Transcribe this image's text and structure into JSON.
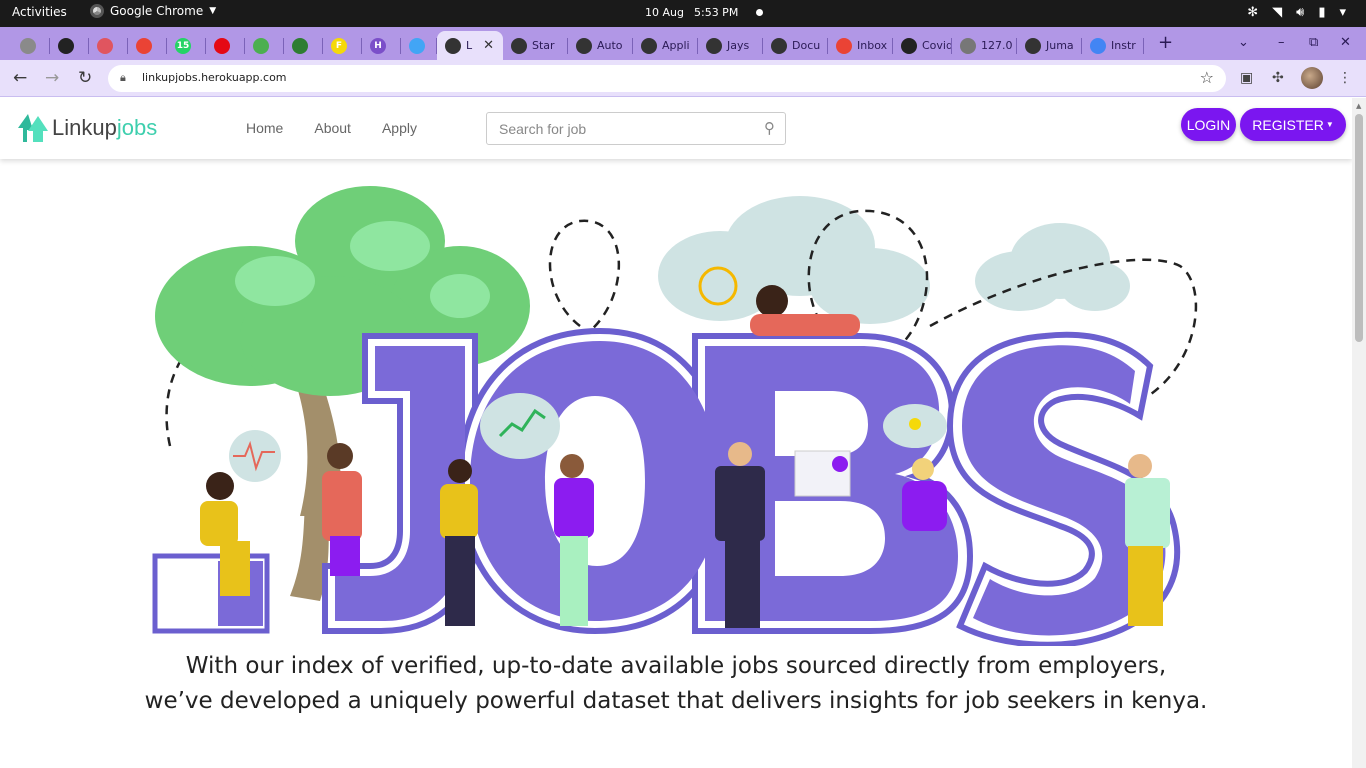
{
  "system": {
    "activities": "Activities",
    "app_name": "Google Chrome",
    "date": "10 Aug",
    "time": "5:53 PM"
  },
  "tabs": [
    {
      "label": "",
      "color": "#8a8a8a"
    },
    {
      "label": "",
      "color": "#222222"
    },
    {
      "label": "",
      "color": "#e0555f"
    },
    {
      "label": "",
      "color": "#ea4335"
    },
    {
      "label": "15",
      "color": "#25d366"
    },
    {
      "label": "",
      "color": "#e50914"
    },
    {
      "label": "",
      "color": "#4caf50"
    },
    {
      "label": "",
      "color": "#2e7d32"
    },
    {
      "label": "F",
      "color": "#f5d90a"
    },
    {
      "label": "H",
      "color": "#7b4fc9"
    },
    {
      "label": "",
      "color": "#42a5f5"
    },
    {
      "label": "L",
      "color": "#333333"
    },
    {
      "label": "Star",
      "color": "#333333"
    },
    {
      "label": "Auto",
      "color": "#333333"
    },
    {
      "label": "Appli",
      "color": "#333333"
    },
    {
      "label": "Jays",
      "color": "#333333"
    },
    {
      "label": "Docu",
      "color": "#333333"
    },
    {
      "label": "Inbox",
      "color": "#ea4335"
    },
    {
      "label": "Covid",
      "color": "#222222"
    },
    {
      "label": "127.0",
      "color": "#777777"
    },
    {
      "label": "Juma",
      "color": "#333333"
    },
    {
      "label": "Instr",
      "color": "#4285f4"
    }
  ],
  "browser": {
    "url": "linkupjobs.herokuapp.com"
  },
  "site": {
    "logo_word1": "Linkup",
    "logo_word2": "jobs",
    "nav": [
      "Home",
      "About",
      "Apply"
    ],
    "search_placeholder": "Search for job",
    "login": "LOGIN",
    "register": "REGISTER",
    "brand_color": "#7b16f0",
    "accent_color": "#3ecfae"
  },
  "hero": {
    "letters": "JOBS",
    "tagline_line1": "With our index of verified, up-to-date available jobs sourced directly from employers,",
    "tagline_line2": "we’ve developed a uniquely powerful dataset that delivers insights for job seekers in kenya."
  }
}
